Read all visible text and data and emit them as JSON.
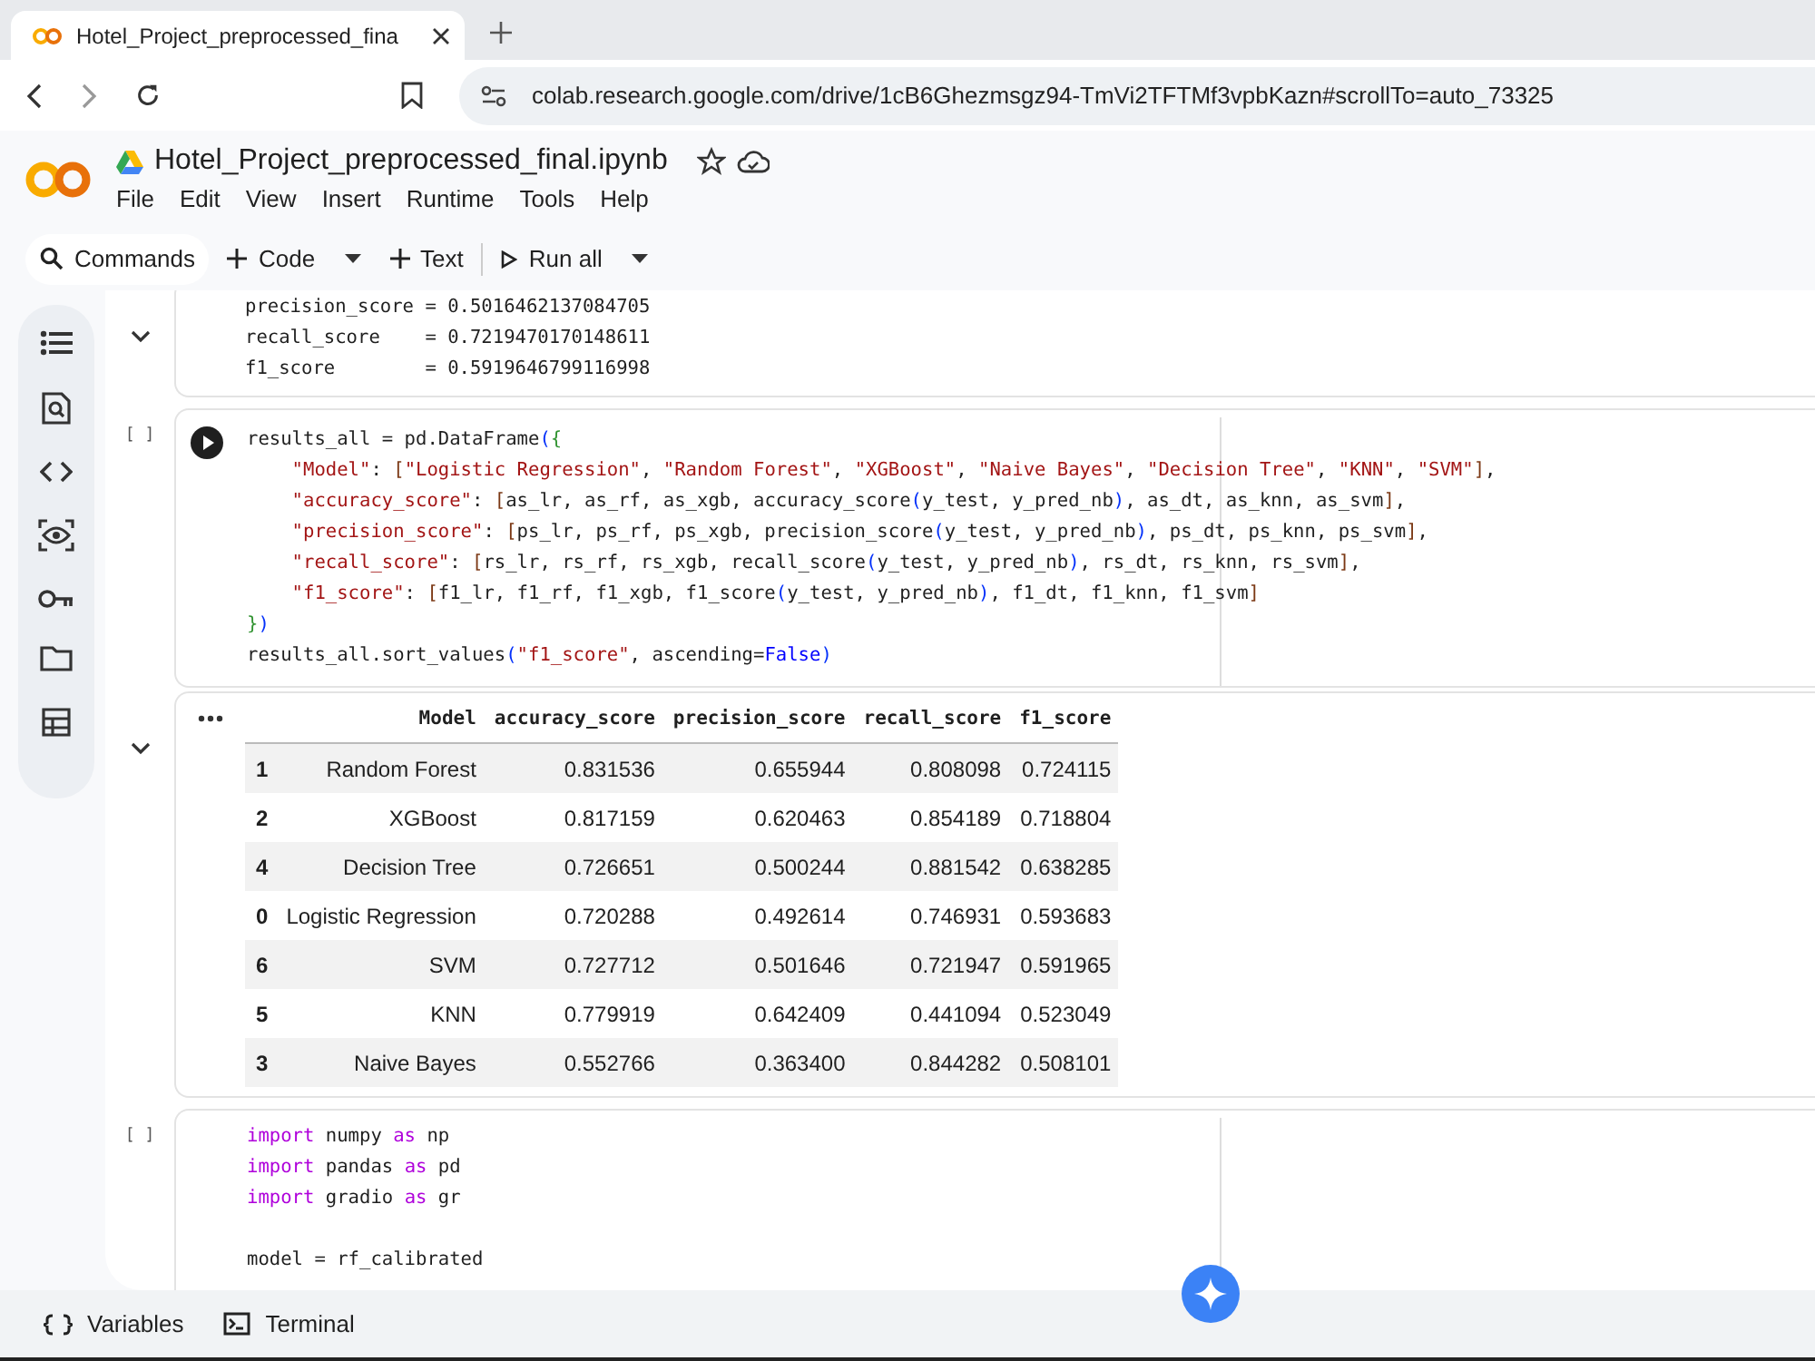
{
  "browser": {
    "tab_title": "Hotel_Project_preprocessed_fina",
    "url": "colab.research.google.com/drive/1cB6Ghezmsgz94-TmVi2TFTMf3vpbKazn#scrollTo=auto_73325"
  },
  "notebook": {
    "title": "Hotel_Project_preprocessed_final.ipynb",
    "menu": [
      "File",
      "Edit",
      "View",
      "Insert",
      "Runtime",
      "Tools",
      "Help"
    ]
  },
  "toolbar": {
    "commands": "Commands",
    "code": "Code",
    "text": "Text",
    "run_all": "Run all"
  },
  "cells": [
    {
      "kind": "text_output",
      "lines": [
        "precision_score = 0.5016462137084705",
        "recall_score    = 0.7219470170148611",
        "f1_score        = 0.5919646799116998"
      ]
    },
    {
      "kind": "code",
      "exec": "[ ]",
      "hovered": true,
      "lines": [
        {
          "indented": false,
          "spaced": false,
          "tokens": [
            {
              "kind": "plain",
              "text": "results_all = pd.DataFrame"
            },
            {
              "kind": "br1",
              "text": "("
            },
            {
              "kind": "br2",
              "text": "{"
            }
          ]
        },
        {
          "indented": true,
          "spaced": false,
          "tokens": [
            {
              "kind": "str",
              "text": "\"Model\""
            },
            {
              "kind": "plain",
              "text": ": "
            },
            {
              "kind": "br3",
              "text": "["
            },
            {
              "kind": "str",
              "text": "\"Logistic Regression\""
            },
            {
              "kind": "plain",
              "text": ", "
            },
            {
              "kind": "str",
              "text": "\"Random Forest\""
            },
            {
              "kind": "plain",
              "text": ", "
            },
            {
              "kind": "str",
              "text": "\"XGBoost\""
            },
            {
              "kind": "plain",
              "text": ", "
            },
            {
              "kind": "str",
              "text": "\"Naive Bayes\""
            },
            {
              "kind": "plain",
              "text": ", "
            },
            {
              "kind": "str",
              "text": "\"Decision Tree\""
            },
            {
              "kind": "plain",
              "text": ", "
            },
            {
              "kind": "str",
              "text": "\"KNN\""
            },
            {
              "kind": "plain",
              "text": ", "
            },
            {
              "kind": "str",
              "text": "\"SVM\""
            },
            {
              "kind": "br3",
              "text": "]"
            },
            {
              "kind": "plain",
              "text": ","
            }
          ]
        },
        {
          "indented": true,
          "spaced": false,
          "tokens": [
            {
              "kind": "str",
              "text": "\"accuracy_score\""
            },
            {
              "kind": "plain",
              "text": ": "
            },
            {
              "kind": "br3",
              "text": "["
            },
            {
              "kind": "plain",
              "text": "as_lr, as_rf, as_xgb, accuracy_score"
            },
            {
              "kind": "br1",
              "text": "("
            },
            {
              "kind": "plain",
              "text": "y_test, y_pred_nb"
            },
            {
              "kind": "br1",
              "text": ")"
            },
            {
              "kind": "plain",
              "text": ", as_dt, as_knn, as_svm"
            },
            {
              "kind": "br3",
              "text": "]"
            },
            {
              "kind": "plain",
              "text": ","
            }
          ]
        },
        {
          "indented": true,
          "spaced": false,
          "tokens": [
            {
              "kind": "str",
              "text": "\"precision_score\""
            },
            {
              "kind": "plain",
              "text": ": "
            },
            {
              "kind": "br3",
              "text": "["
            },
            {
              "kind": "plain",
              "text": "ps_lr, ps_rf, ps_xgb, precision_score"
            },
            {
              "kind": "br1",
              "text": "("
            },
            {
              "kind": "plain",
              "text": "y_test, y_pred_nb"
            },
            {
              "kind": "br1",
              "text": ")"
            },
            {
              "kind": "plain",
              "text": ", ps_dt, ps_knn, ps_svm"
            },
            {
              "kind": "br3",
              "text": "]"
            },
            {
              "kind": "plain",
              "text": ","
            }
          ]
        },
        {
          "indented": true,
          "spaced": false,
          "tokens": [
            {
              "kind": "str",
              "text": "\"recall_score\""
            },
            {
              "kind": "plain",
              "text": ": "
            },
            {
              "kind": "br3",
              "text": "["
            },
            {
              "kind": "plain",
              "text": "rs_lr, rs_rf, rs_xgb, recall_score"
            },
            {
              "kind": "br1",
              "text": "("
            },
            {
              "kind": "plain",
              "text": "y_test, y_pred_nb"
            },
            {
              "kind": "br1",
              "text": ")"
            },
            {
              "kind": "plain",
              "text": ", rs_dt, rs_knn, rs_svm"
            },
            {
              "kind": "br3",
              "text": "]"
            },
            {
              "kind": "plain",
              "text": ","
            }
          ]
        },
        {
          "indented": true,
          "spaced": false,
          "tokens": [
            {
              "kind": "str",
              "text": "\"f1_score\""
            },
            {
              "kind": "plain",
              "text": ": "
            },
            {
              "kind": "br3",
              "text": "["
            },
            {
              "kind": "plain",
              "text": "f1_lr, f1_rf, f1_xgb, f1_score"
            },
            {
              "kind": "br1",
              "text": "("
            },
            {
              "kind": "plain",
              "text": "y_test, y_pred_nb"
            },
            {
              "kind": "br1",
              "text": ")"
            },
            {
              "kind": "plain",
              "text": ", f1_dt, f1_knn, f1_svm"
            },
            {
              "kind": "br3",
              "text": "]"
            }
          ]
        },
        {
          "indented": false,
          "spaced": false,
          "tokens": [
            {
              "kind": "br2",
              "text": "}"
            },
            {
              "kind": "br1",
              "text": ")"
            }
          ]
        },
        {
          "indented": false,
          "spaced": false,
          "tokens": [
            {
              "kind": "plain",
              "text": "results_all.sort_values"
            },
            {
              "kind": "br1",
              "text": "("
            },
            {
              "kind": "str",
              "text": "\"f1_score\""
            },
            {
              "kind": "plain",
              "text": ", ascending="
            },
            {
              "kind": "bool",
              "text": "False"
            },
            {
              "kind": "br1",
              "text": ")"
            }
          ]
        }
      ]
    },
    {
      "kind": "table_output",
      "columns": [
        "Model",
        "accuracy_score",
        "precision_score",
        "recall_score",
        "f1_score"
      ],
      "rows": [
        {
          "index": "1",
          "cells": [
            "Random Forest",
            "0.831536",
            "0.655944",
            "0.808098",
            "0.724115"
          ]
        },
        {
          "index": "2",
          "cells": [
            "XGBoost",
            "0.817159",
            "0.620463",
            "0.854189",
            "0.718804"
          ]
        },
        {
          "index": "4",
          "cells": [
            "Decision Tree",
            "0.726651",
            "0.500244",
            "0.881542",
            "0.638285"
          ]
        },
        {
          "index": "0",
          "cells": [
            "Logistic Regression",
            "0.720288",
            "0.492614",
            "0.746931",
            "0.593683"
          ]
        },
        {
          "index": "6",
          "cells": [
            "SVM",
            "0.727712",
            "0.501646",
            "0.721947",
            "0.591965"
          ]
        },
        {
          "index": "5",
          "cells": [
            "KNN",
            "0.779919",
            "0.642409",
            "0.441094",
            "0.523049"
          ]
        },
        {
          "index": "3",
          "cells": [
            "Naive Bayes",
            "0.552766",
            "0.363400",
            "0.844282",
            "0.508101"
          ]
        }
      ]
    },
    {
      "kind": "code",
      "exec": "[ ]",
      "hovered": false,
      "lines": [
        {
          "indented": false,
          "spaced": false,
          "tokens": [
            {
              "kind": "kw",
              "text": "import"
            },
            {
              "kind": "plain",
              "text": " numpy "
            },
            {
              "kind": "kw",
              "text": "as"
            },
            {
              "kind": "plain",
              "text": " np"
            }
          ]
        },
        {
          "indented": false,
          "spaced": false,
          "tokens": [
            {
              "kind": "kw",
              "text": "import"
            },
            {
              "kind": "plain",
              "text": " pandas "
            },
            {
              "kind": "kw",
              "text": "as"
            },
            {
              "kind": "plain",
              "text": " pd"
            }
          ]
        },
        {
          "indented": false,
          "spaced": false,
          "tokens": [
            {
              "kind": "kw",
              "text": "import"
            },
            {
              "kind": "plain",
              "text": " gradio "
            },
            {
              "kind": "kw",
              "text": "as"
            },
            {
              "kind": "plain",
              "text": " gr"
            }
          ]
        },
        {
          "indented": false,
          "spaced": true,
          "tokens": [
            {
              "kind": "plain",
              "text": "model = rf_calibrated"
            }
          ]
        }
      ]
    }
  ],
  "bottom_bar": {
    "variables": "Variables",
    "terminal": "Terminal"
  }
}
